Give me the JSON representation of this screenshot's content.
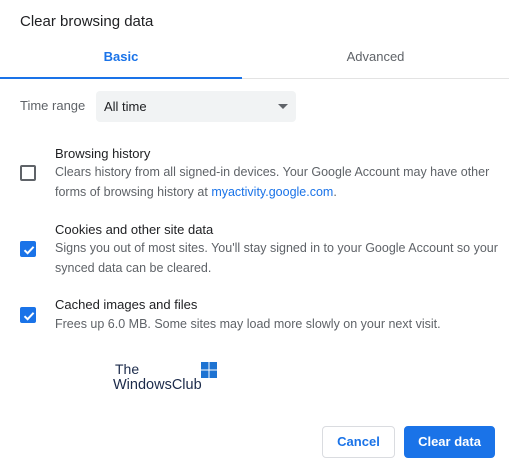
{
  "dialog": {
    "title": "Clear browsing data"
  },
  "tabs": [
    {
      "label": "Basic",
      "selected": true
    },
    {
      "label": "Advanced",
      "selected": false
    }
  ],
  "time_range": {
    "label": "Time range",
    "value": "All time"
  },
  "options": [
    {
      "title": "Browsing history",
      "description": "Clears history from all signed-in devices. Your Google Account may have other forms of browsing history at ",
      "link": "myactivity.google.com",
      "description_end": ".",
      "checked": false
    },
    {
      "title": "Cookies and other site data",
      "description": "Signs you out of most sites. You'll stay signed in to your Google Account so your synced data can be cleared.",
      "checked": true
    },
    {
      "title": "Cached images and files",
      "description": "Frees up 6.0 MB. Some sites may load more slowly on your next visit.",
      "checked": true
    }
  ],
  "watermark": {
    "line1": "The",
    "line2": "WindowsClub"
  },
  "buttons": {
    "cancel": "Cancel",
    "clear": "Clear data"
  },
  "colors": {
    "accent": "#1a73e8",
    "text_primary": "#202124",
    "text_secondary": "#5f6368",
    "select_bg": "#f1f3f4"
  },
  "icons": {
    "checkbox_checked": "check-icon",
    "dropdown": "chevron-down-icon",
    "logo": "windows-flag-icon"
  }
}
